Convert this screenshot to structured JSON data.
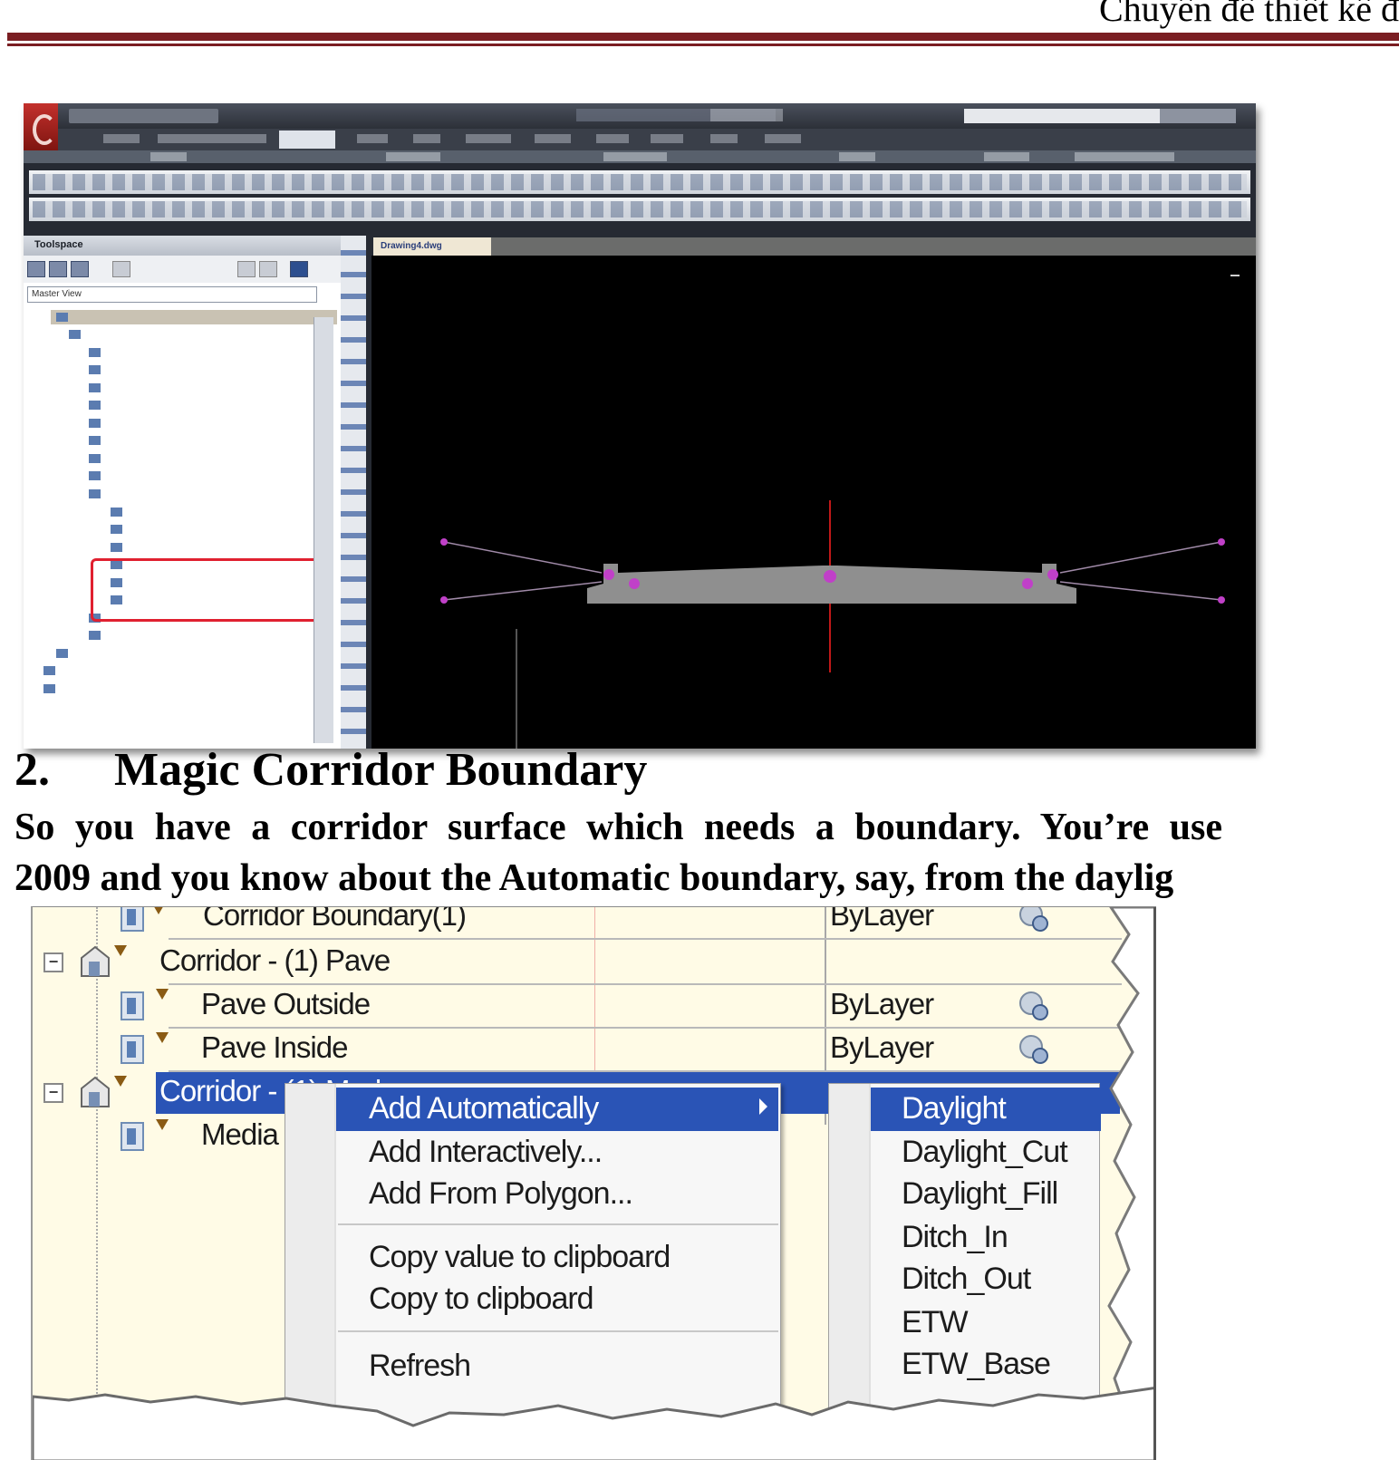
{
  "document": {
    "header_text": "Chuyên đề thiết kế đ"
  },
  "window": {
    "toolspace_title": "Toolspace",
    "view_select": "Master View",
    "drawing_tab": "Drawing4.dwg",
    "colors": {
      "accent_rule": "#7a1e22",
      "selection_blue": "#2a54b6",
      "highlight_red": "#e02030",
      "viewport_bg": "#000000"
    }
  },
  "section": {
    "number": "2.",
    "title": "Magic Corridor Boundary",
    "body_lines": [
      "So you have a corridor surface which needs a boundary.  You’re use",
      "2009 and you know about the Automatic boundary, say, from the daylig"
    ]
  },
  "prospector": {
    "rows": [
      {
        "label": "Corridor Boundary(1)",
        "value": "ByLayer",
        "level": "child",
        "cut": true
      },
      {
        "label": "Corridor - (1) Pave",
        "value": "",
        "level": "parent"
      },
      {
        "label": "Pave Outside",
        "value": "ByLayer",
        "level": "child"
      },
      {
        "label": "Pave Inside",
        "value": "ByLayer",
        "level": "child"
      },
      {
        "label": "Corridor - (1) Med",
        "value": "",
        "level": "parent",
        "selected": true
      },
      {
        "label": "Media",
        "value": "",
        "level": "child"
      }
    ],
    "context_menu": {
      "items": [
        {
          "label": "Add Automatically",
          "active": true,
          "submenu": true
        },
        {
          "label": "Add Interactively..."
        },
        {
          "label": "Add From Polygon..."
        },
        {
          "separator": true
        },
        {
          "label": "Copy value to clipboard"
        },
        {
          "label": "Copy to clipboard"
        },
        {
          "separator": true
        },
        {
          "label": "Refresh"
        }
      ]
    },
    "submenu": {
      "items": [
        "Daylight",
        "Daylight_Cut",
        "Daylight_Fill",
        "Ditch_In",
        "Ditch_Out",
        "ETW",
        "ETW_Base"
      ]
    }
  }
}
